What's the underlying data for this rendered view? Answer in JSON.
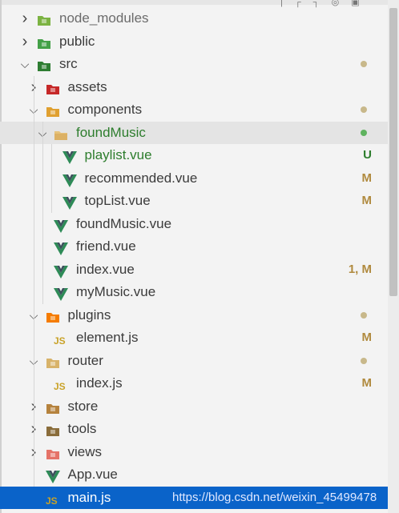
{
  "top_strip_icons": "| ┌ ┐ ◎ ▣",
  "tree": [
    {
      "label": "node_modules",
      "kind": "folder",
      "icon": "node-folder-icon",
      "expanded": false,
      "status": "",
      "dot": false,
      "color": "#6b6b6b"
    },
    {
      "label": "public",
      "kind": "folder",
      "icon": "public-folder-icon",
      "expanded": false,
      "status": "",
      "dot": false
    },
    {
      "label": "src",
      "kind": "folder",
      "icon": "src-folder-icon",
      "expanded": true,
      "status": "",
      "dot": true
    },
    {
      "label": "assets",
      "kind": "folder",
      "icon": "assets-folder-icon",
      "expanded": false,
      "status": "",
      "dot": false
    },
    {
      "label": "components",
      "kind": "folder",
      "icon": "components-folder-icon",
      "expanded": true,
      "status": "",
      "dot": true
    },
    {
      "label": "foundMusic",
      "kind": "folder",
      "icon": "folder-open-icon",
      "expanded": true,
      "status": "",
      "dot": true,
      "green": true,
      "selected_parent": true
    },
    {
      "label": "playlist.vue",
      "kind": "file",
      "icon": "vue-icon",
      "status": "U",
      "dot": false,
      "green": true
    },
    {
      "label": "recommended.vue",
      "kind": "file",
      "icon": "vue-icon",
      "status": "M",
      "dot": false
    },
    {
      "label": "topList.vue",
      "kind": "file",
      "icon": "vue-icon",
      "status": "M",
      "dot": false
    },
    {
      "label": "foundMusic.vue",
      "kind": "file",
      "icon": "vue-icon",
      "status": "",
      "dot": false
    },
    {
      "label": "friend.vue",
      "kind": "file",
      "icon": "vue-icon",
      "status": "",
      "dot": false
    },
    {
      "label": "index.vue",
      "kind": "file",
      "icon": "vue-icon",
      "status": "1, M",
      "dot": false
    },
    {
      "label": "myMusic.vue",
      "kind": "file",
      "icon": "vue-icon",
      "status": "",
      "dot": false
    },
    {
      "label": "plugins",
      "kind": "folder",
      "icon": "plugins-folder-icon",
      "expanded": true,
      "status": "",
      "dot": true
    },
    {
      "label": "element.js",
      "kind": "file",
      "icon": "js-icon",
      "status": "M",
      "dot": false
    },
    {
      "label": "router",
      "kind": "folder",
      "icon": "router-folder-icon",
      "expanded": true,
      "status": "",
      "dot": true
    },
    {
      "label": "index.js",
      "kind": "file",
      "icon": "js-icon",
      "status": "M",
      "dot": false
    },
    {
      "label": "store",
      "kind": "folder",
      "icon": "store-folder-icon",
      "expanded": false,
      "status": "",
      "dot": false
    },
    {
      "label": "tools",
      "kind": "folder",
      "icon": "tools-folder-icon",
      "expanded": false,
      "status": "",
      "dot": false
    },
    {
      "label": "views",
      "kind": "folder",
      "icon": "views-folder-icon",
      "expanded": false,
      "status": "",
      "dot": false
    },
    {
      "label": "App.vue",
      "kind": "file",
      "icon": "vue-icon",
      "status": "",
      "dot": false
    },
    {
      "label": "main.js",
      "kind": "file",
      "icon": "js-icon",
      "status": "",
      "dot": false,
      "active": true
    }
  ],
  "watermark": "https://blog.csdn.net/weixin_45499478",
  "colors": {
    "selection": "#0a63c9",
    "modified": "#b08a3e",
    "untracked": "#2d7d2d",
    "vue": "#2e8b57",
    "js": "#c9a227",
    "dot": "#c8b88a",
    "dot_green": "#5fb35f"
  }
}
